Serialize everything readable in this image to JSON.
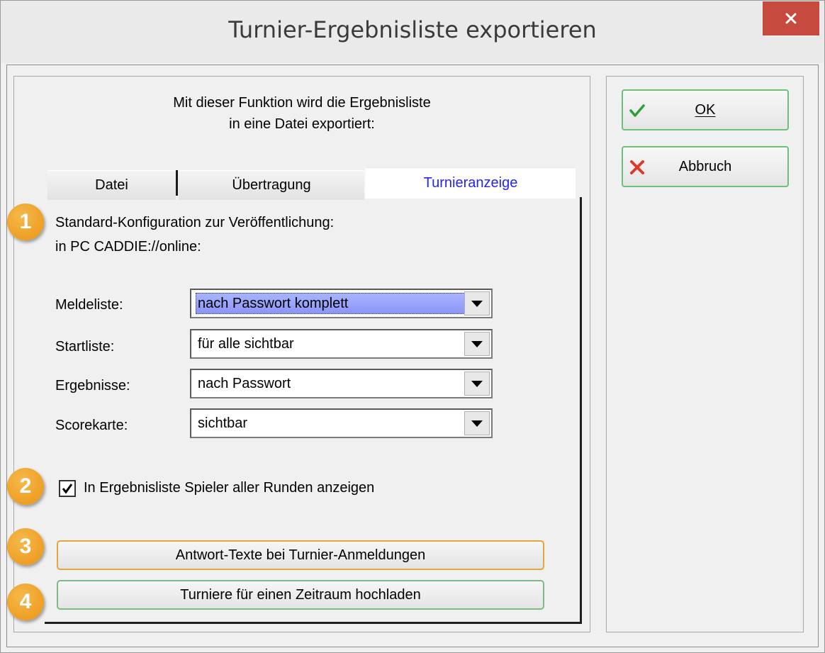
{
  "window": {
    "title": "Turnier-Ergebnisliste exportieren",
    "close_glyph": "✕"
  },
  "intro": {
    "line1": "Mit dieser Funktion wird die Ergebnisliste",
    "line2": "in eine Datei exportiert:"
  },
  "tabs": [
    {
      "label": "Datei",
      "active": false
    },
    {
      "label": "Übertragung",
      "active": false
    },
    {
      "label": "Turnieranzeige",
      "active": true
    }
  ],
  "panel": {
    "config_line1": "Standard-Konfiguration zur Veröffentlichung:",
    "config_line2": "in PC CADDIE://online:",
    "fields": [
      {
        "label": "Meldeliste:",
        "value": "nach Passwort komplett",
        "selected": true
      },
      {
        "label": "Startliste:",
        "value": "für alle sichtbar",
        "selected": false
      },
      {
        "label": "Ergebnisse:",
        "value": "nach Passwort",
        "selected": false
      },
      {
        "label": "Scorekarte:",
        "value": "sichtbar",
        "selected": false
      }
    ],
    "checkbox": {
      "label": "In Ergebnisliste Spieler aller Runden anzeigen",
      "checked": true
    },
    "button_response_texts": "Antwort-Texte bei Turnier-Anmeldungen",
    "button_upload_period": "Turniere für einen Zeitraum hochladen"
  },
  "side_buttons": {
    "ok_label": "OK",
    "ok_icon": "checkmark-icon",
    "cancel_label": "Abbruch",
    "cancel_icon": "red-x-icon"
  },
  "badges": [
    "1",
    "2",
    "3",
    "4"
  ],
  "colors": {
    "badge": "#ea9414",
    "active_tab_text": "#2323ff",
    "close_button": "#c74a3e",
    "button_border_green": "#6dbf7a",
    "button_border_orange": "#e3a63d",
    "selection": "#8b95f8"
  }
}
